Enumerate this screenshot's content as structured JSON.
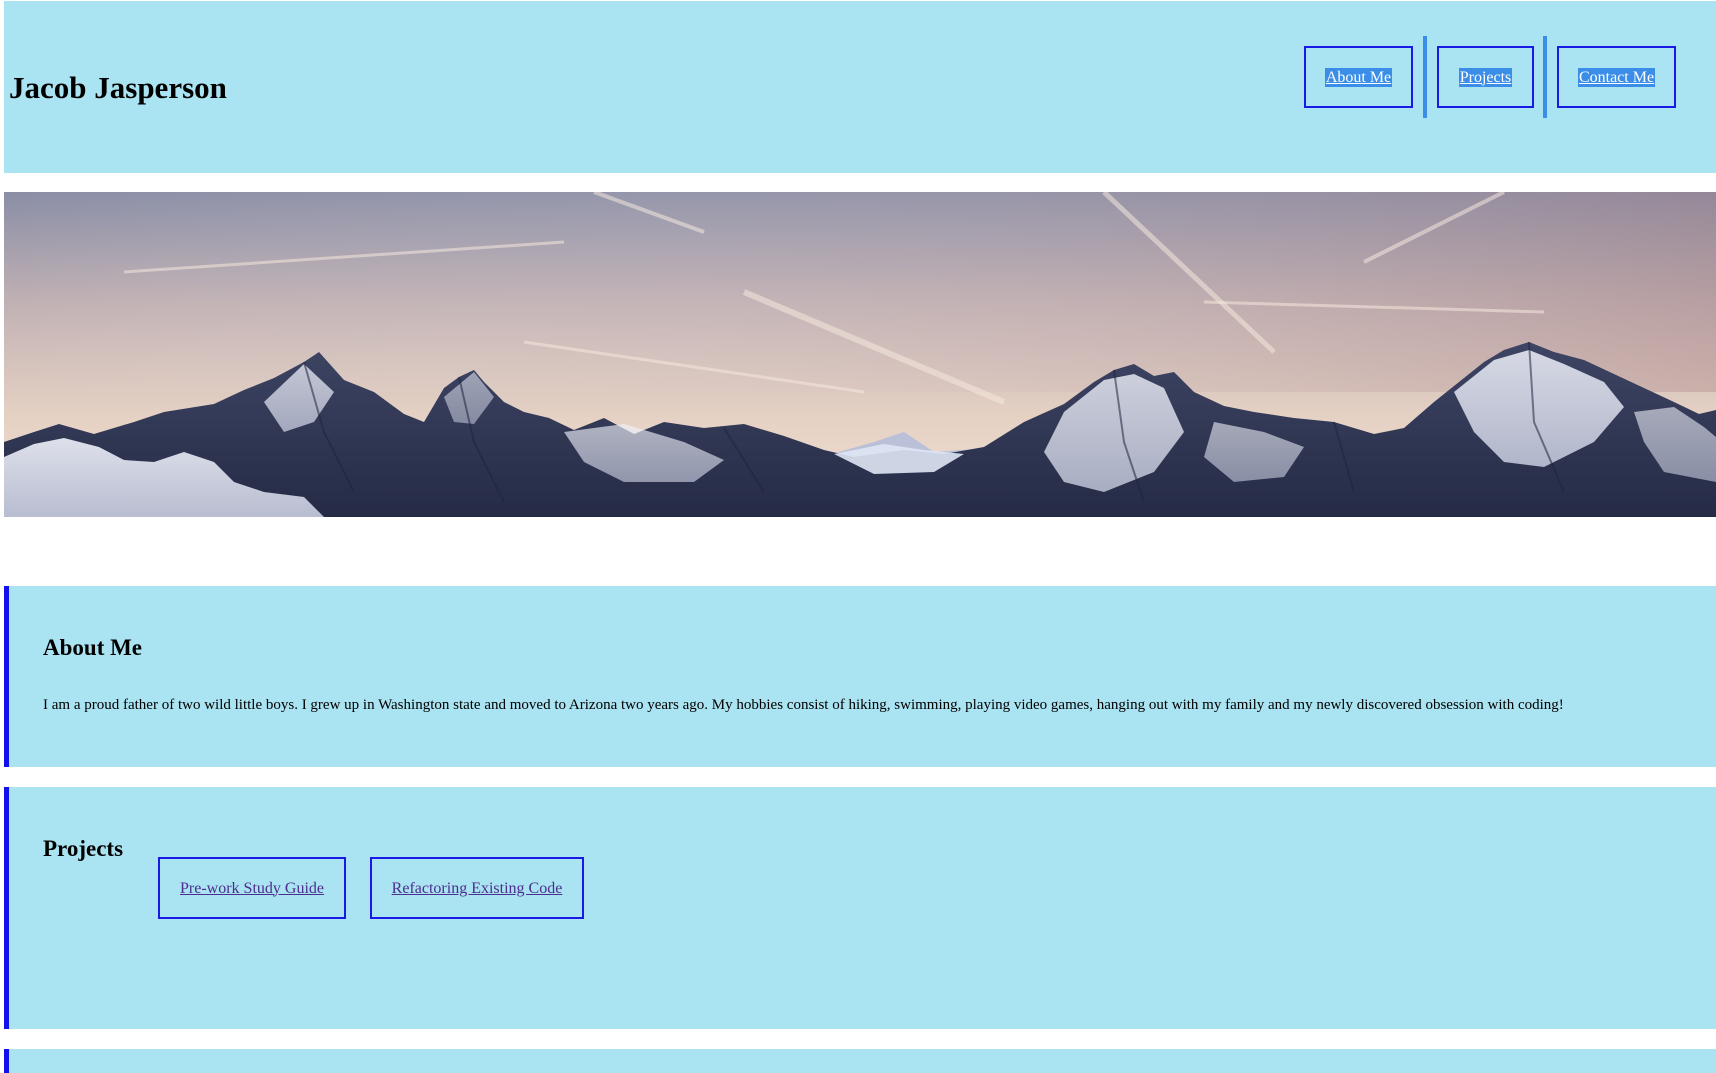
{
  "header": {
    "title": "Jacob Jasperson",
    "nav": [
      {
        "label": "About Me"
      },
      {
        "label": "Projects"
      },
      {
        "label": "Contact Me"
      }
    ]
  },
  "hero": {
    "alt": "Snowy mountain range under a pastel sky"
  },
  "about": {
    "heading": "About Me",
    "text": "I am a proud father of two wild little boys. I grew up in Washington state and moved to Arizona two years ago. My hobbies consist of hiking, swimming, playing video games, hanging out with my family and my newly discovered obsession with coding!"
  },
  "projects": {
    "heading": "Projects",
    "items": [
      {
        "label": "Pre-work Study Guide"
      },
      {
        "label": "Refactoring Existing Code"
      }
    ]
  },
  "colors": {
    "section_bg": "#aae3f1",
    "accent_border": "#1111ee",
    "nav_highlight": "#3a8ee8"
  }
}
